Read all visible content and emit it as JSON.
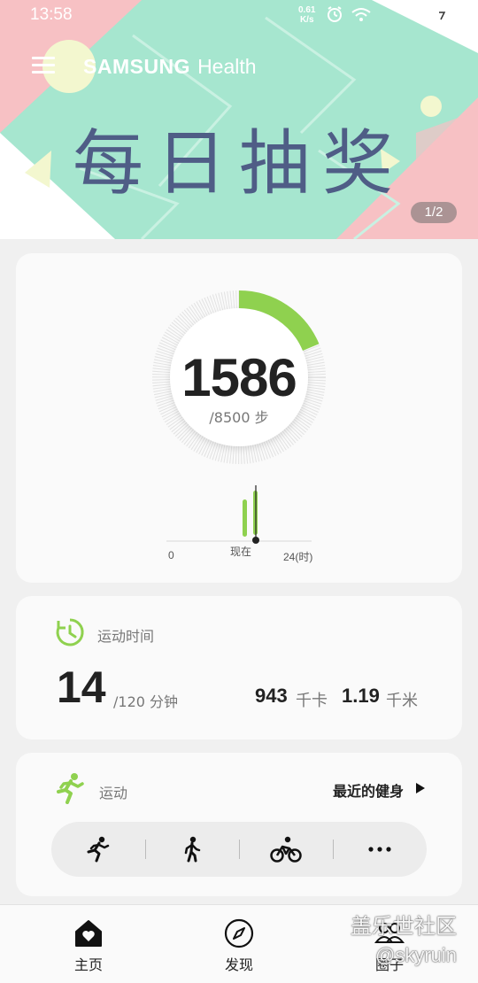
{
  "status_bar": {
    "time": "13:58",
    "net_speed_value": "0.61",
    "net_speed_unit": "K/s"
  },
  "banner": {
    "brand": "SAMSUNG",
    "brand_suffix": "Health",
    "title": "每日抽奖",
    "page_indicator": "1/2"
  },
  "steps": {
    "value": "1586",
    "goal_label": "/8500 步",
    "progress": 0.187,
    "chart_start": "0",
    "chart_now": "现在",
    "chart_end": "24(时)"
  },
  "exercise": {
    "title": "运动时间",
    "minutes": "14",
    "goal_label": "/120 分钟",
    "kcal": "943",
    "kcal_unit": "千卡",
    "km": "1.19",
    "km_unit": "千米"
  },
  "workout": {
    "title": "运动",
    "recent_label": "最近的健身",
    "activities": [
      "running-icon",
      "walking-icon",
      "cycling-icon",
      "more-icon"
    ]
  },
  "nav": {
    "items": [
      {
        "label": "主页",
        "icon": "home-heart-icon"
      },
      {
        "label": "发现",
        "icon": "compass-icon"
      },
      {
        "label": "圈子",
        "icon": "people-icon"
      }
    ]
  },
  "watermark": {
    "line1": "盖乐世社区",
    "line2": "@skyruin"
  },
  "colors": {
    "accent_green": "#8fd14f",
    "title_blue": "#4f5d86",
    "banner_mint": "#a6e6cf",
    "banner_pink": "#f7c1c4"
  }
}
